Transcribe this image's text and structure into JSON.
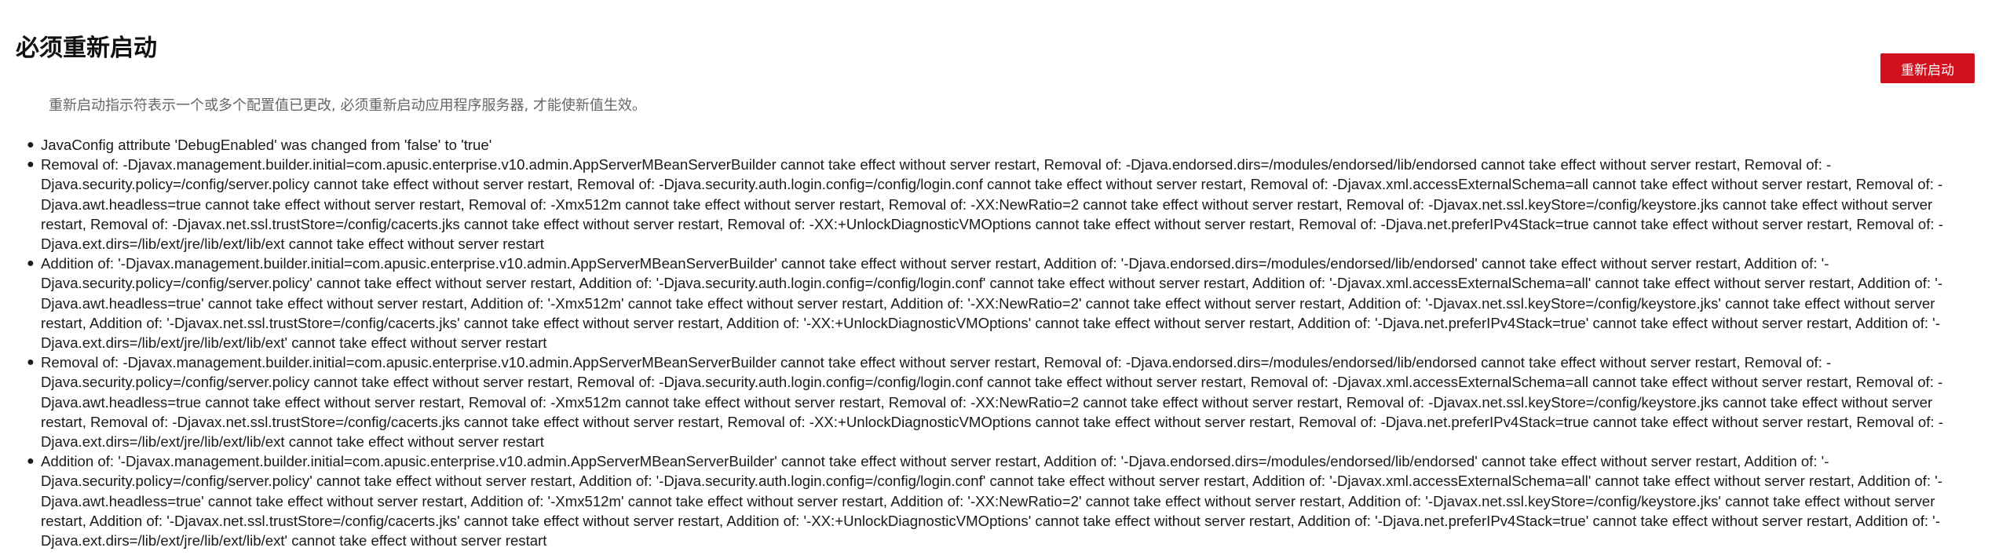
{
  "header": {
    "title": "必须重新启动",
    "restart_button_label": "重新启动"
  },
  "description": "重新启动指示符表示一个或多个配置值已更改, 必须重新启动应用程序服务器, 才能使新值生效。",
  "messages": [
    "JavaConfig attribute 'DebugEnabled' was changed from 'false' to 'true'",
    "Removal of: -Djavax.management.builder.initial=com.apusic.enterprise.v10.admin.AppServerMBeanServerBuilder cannot take effect without server restart, Removal of: -Djava.endorsed.dirs=/modules/endorsed/lib/endorsed cannot take effect without server restart, Removal of: -Djava.security.policy=/config/server.policy cannot take effect without server restart, Removal of: -Djava.security.auth.login.config=/config/login.conf cannot take effect without server restart, Removal of: -Djavax.xml.accessExternalSchema=all cannot take effect without server restart, Removal of: -Djava.awt.headless=true cannot take effect without server restart, Removal of: -Xmx512m cannot take effect without server restart, Removal of: -XX:NewRatio=2 cannot take effect without server restart, Removal of: -Djavax.net.ssl.keyStore=/config/keystore.jks cannot take effect without server restart, Removal of: -Djavax.net.ssl.trustStore=/config/cacerts.jks cannot take effect without server restart, Removal of: -XX:+UnlockDiagnosticVMOptions cannot take effect without server restart, Removal of: -Djava.net.preferIPv4Stack=true cannot take effect without server restart, Removal of: -Djava.ext.dirs=/lib/ext/jre/lib/ext/lib/ext cannot take effect without server restart",
    "Addition of: '-Djavax.management.builder.initial=com.apusic.enterprise.v10.admin.AppServerMBeanServerBuilder' cannot take effect without server restart, Addition of: '-Djava.endorsed.dirs=/modules/endorsed/lib/endorsed' cannot take effect without server restart, Addition of: '-Djava.security.policy=/config/server.policy' cannot take effect without server restart, Addition of: '-Djava.security.auth.login.config=/config/login.conf' cannot take effect without server restart, Addition of: '-Djavax.xml.accessExternalSchema=all' cannot take effect without server restart, Addition of: '-Djava.awt.headless=true' cannot take effect without server restart, Addition of: '-Xmx512m' cannot take effect without server restart, Addition of: '-XX:NewRatio=2' cannot take effect without server restart, Addition of: '-Djavax.net.ssl.keyStore=/config/keystore.jks' cannot take effect without server restart, Addition of: '-Djavax.net.ssl.trustStore=/config/cacerts.jks' cannot take effect without server restart, Addition of: '-XX:+UnlockDiagnosticVMOptions' cannot take effect without server restart, Addition of: '-Djava.net.preferIPv4Stack=true' cannot take effect without server restart, Addition of: '-Djava.ext.dirs=/lib/ext/jre/lib/ext/lib/ext' cannot take effect without server restart",
    "Removal of: -Djavax.management.builder.initial=com.apusic.enterprise.v10.admin.AppServerMBeanServerBuilder cannot take effect without server restart, Removal of: -Djava.endorsed.dirs=/modules/endorsed/lib/endorsed cannot take effect without server restart, Removal of: -Djava.security.policy=/config/server.policy cannot take effect without server restart, Removal of: -Djava.security.auth.login.config=/config/login.conf cannot take effect without server restart, Removal of: -Djavax.xml.accessExternalSchema=all cannot take effect without server restart, Removal of: -Djava.awt.headless=true cannot take effect without server restart, Removal of: -Xmx512m cannot take effect without server restart, Removal of: -XX:NewRatio=2 cannot take effect without server restart, Removal of: -Djavax.net.ssl.keyStore=/config/keystore.jks cannot take effect without server restart, Removal of: -Djavax.net.ssl.trustStore=/config/cacerts.jks cannot take effect without server restart, Removal of: -XX:+UnlockDiagnosticVMOptions cannot take effect without server restart, Removal of: -Djava.net.preferIPv4Stack=true cannot take effect without server restart, Removal of: -Djava.ext.dirs=/lib/ext/jre/lib/ext/lib/ext cannot take effect without server restart",
    "Addition of: '-Djavax.management.builder.initial=com.apusic.enterprise.v10.admin.AppServerMBeanServerBuilder' cannot take effect without server restart, Addition of: '-Djava.endorsed.dirs=/modules/endorsed/lib/endorsed' cannot take effect without server restart, Addition of: '-Djava.security.policy=/config/server.policy' cannot take effect without server restart, Addition of: '-Djava.security.auth.login.config=/config/login.conf' cannot take effect without server restart, Addition of: '-Djavax.xml.accessExternalSchema=all' cannot take effect without server restart, Addition of: '-Djava.awt.headless=true' cannot take effect without server restart, Addition of: '-Xmx512m' cannot take effect without server restart, Addition of: '-XX:NewRatio=2' cannot take effect without server restart, Addition of: '-Djavax.net.ssl.keyStore=/config/keystore.jks' cannot take effect without server restart, Addition of: '-Djavax.net.ssl.trustStore=/config/cacerts.jks' cannot take effect without server restart, Addition of: '-XX:+UnlockDiagnosticVMOptions' cannot take effect without server restart, Addition of: '-Djava.net.preferIPv4Stack=true' cannot take effect without server restart, Addition of: '-Djava.ext.dirs=/lib/ext/jre/lib/ext/lib/ext' cannot take effect without server restart"
  ],
  "colors": {
    "button_background": "#d0101d",
    "button_text": "#ffffff",
    "description_text": "#666666",
    "body_text": "#1a1a1a"
  }
}
